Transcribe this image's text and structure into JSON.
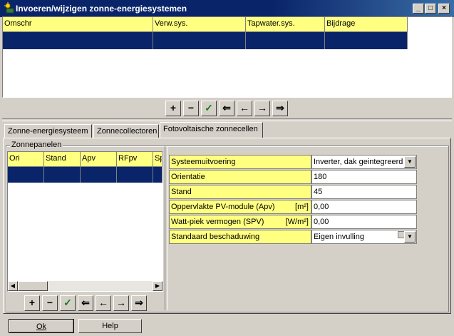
{
  "window": {
    "title": "Invoeren/wijzigen zonne-energiesystemen"
  },
  "title_buttons": {
    "minimize": "_",
    "maximize": "□",
    "close": "×"
  },
  "top_grid": {
    "headers": [
      "Omschr",
      "Verw.sys.",
      "Tapwater.sys.",
      "Bijdrage"
    ]
  },
  "nav_glyphs": {
    "add": "+",
    "delete": "−",
    "confirm": "✓",
    "first": "⇐",
    "prev": "←",
    "next": "→",
    "last": "⇒"
  },
  "tabs": [
    {
      "label": "Zonne-energiesysteem"
    },
    {
      "label": "Zonnecollectoren"
    },
    {
      "label": "Fotovoltaische zonnecellen"
    }
  ],
  "panel_group": {
    "label": "Zonnepanelen"
  },
  "panel_grid": {
    "headers": [
      "Ori",
      "Stand",
      "Apv",
      "RFpv",
      "Sp"
    ]
  },
  "properties": [
    {
      "label": "Systeemuitvoering",
      "unit": "",
      "value": "Inverter, dak geintegreerd"
    },
    {
      "label": "Orientatie",
      "unit": "",
      "value": "180"
    },
    {
      "label": "Stand",
      "unit": "",
      "value": "45"
    },
    {
      "label": "Oppervlakte PV-module (Apv)",
      "unit": "[m²]",
      "value": "0,00"
    },
    {
      "label": "Watt-piek vermogen (SPV)",
      "unit": "[W/m²]",
      "value": "0,00"
    },
    {
      "label": "Standaard beschaduwing",
      "unit": "",
      "value": "Eigen invulling"
    }
  ],
  "footer": {
    "ok": "Ok",
    "help": "Help"
  }
}
